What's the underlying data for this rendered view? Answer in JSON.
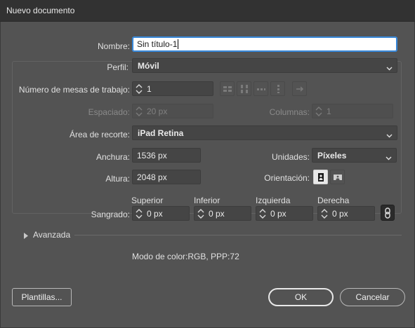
{
  "window": {
    "title": "Nuevo documento"
  },
  "form": {
    "nombre": {
      "label": "Nombre:",
      "value": "Sin título-1"
    },
    "perfil": {
      "label": "Perfil:",
      "value": "Móvil"
    },
    "mesas": {
      "label": "Número de mesas de trabajo:",
      "value": "1"
    },
    "espaciado": {
      "label": "Espaciado:",
      "value": "20 px"
    },
    "columnas": {
      "label": "Columnas:",
      "value": "1"
    },
    "area_recorte": {
      "label": "Área de recorte:",
      "value": "iPad Retina"
    },
    "anchura": {
      "label": "Anchura:",
      "value": "1536 px"
    },
    "altura": {
      "label": "Altura:",
      "value": "2048 px"
    },
    "unidades": {
      "label": "Unidades:",
      "value": "Píxeles"
    },
    "orientacion": {
      "label": "Orientación:"
    },
    "sangrado": {
      "label": "Sangrado:",
      "superior": {
        "label": "Superior",
        "value": "0 px"
      },
      "inferior": {
        "label": "Inferior",
        "value": "0 px"
      },
      "izquierda": {
        "label": "Izquierda",
        "value": "0 px"
      },
      "derecha": {
        "label": "Derecha",
        "value": "0 px"
      }
    },
    "avanzada": {
      "label": "Avanzada"
    },
    "color_info": "Modo de color:RGB, PPP:72"
  },
  "buttons": {
    "plantillas": "Plantillas...",
    "ok": "OK",
    "cancelar": "Cancelar"
  },
  "icons": {
    "artboard_arrange": [
      "grid-by-row-icon",
      "grid-by-column-icon",
      "arrange-by-row-icon",
      "arrange-by-column-icon",
      "right-to-left-icon"
    ],
    "orientation": [
      "portrait-icon",
      "landscape-icon"
    ],
    "link": "link-chain-icon"
  }
}
